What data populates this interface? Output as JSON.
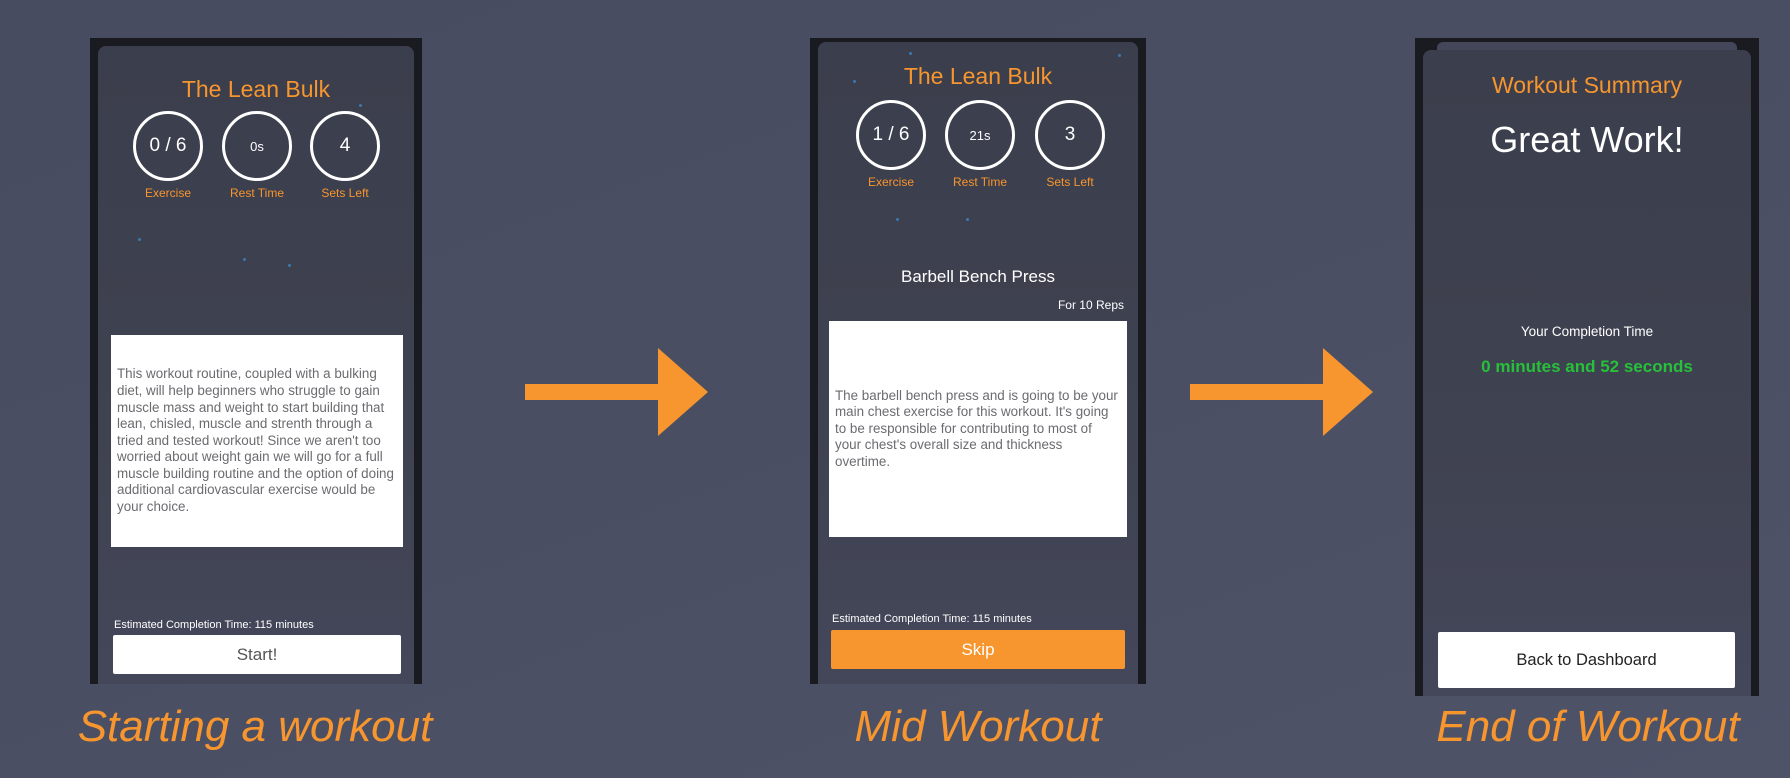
{
  "screens": [
    {
      "title": "The Lean Bulk",
      "stats": [
        {
          "value": "0 / 6",
          "label": "Exercise"
        },
        {
          "value": "0s",
          "label": "Rest Time"
        },
        {
          "value": "4",
          "label": "Sets Left"
        }
      ],
      "description": "This workout routine, coupled with a bulking diet, will help beginners who struggle to gain muscle mass and weight to start building that lean, chisled, muscle and strenth through a tried and tested workout! Since we aren't too worried about weight gain we will go for a full muscle building routine and the option of doing additional cardiovascular exercise would be your choice.",
      "eta": "Estimated Completion Time: 115 minutes",
      "button_label": "Start!",
      "caption": "Starting a workout"
    },
    {
      "title": "The Lean Bulk",
      "stats": [
        {
          "value": "1 / 6",
          "label": "Exercise"
        },
        {
          "value": "21s",
          "label": "Rest Time"
        },
        {
          "value": "3",
          "label": "Sets Left"
        }
      ],
      "exercise_name": "Barbell Bench Press",
      "reps": "For 10 Reps",
      "description": "The barbell bench press and is going to be your main chest exercise for this workout. It's going to be responsible for contributing to most of your chest's overall size and thickness overtime.",
      "eta": "Estimated Completion Time: 115 minutes",
      "button_label": "Skip",
      "caption": "Mid Workout"
    },
    {
      "title": "Workout Summary",
      "headline": "Great Work!",
      "completion_label": "Your Completion Time",
      "completion_value": "0 minutes and 52 seconds",
      "button_label": "Back to Dashboard",
      "caption": "End of Workout"
    }
  ],
  "colors": {
    "accent": "#f7952e",
    "success": "#27c03a",
    "background": "#4a4e62"
  }
}
